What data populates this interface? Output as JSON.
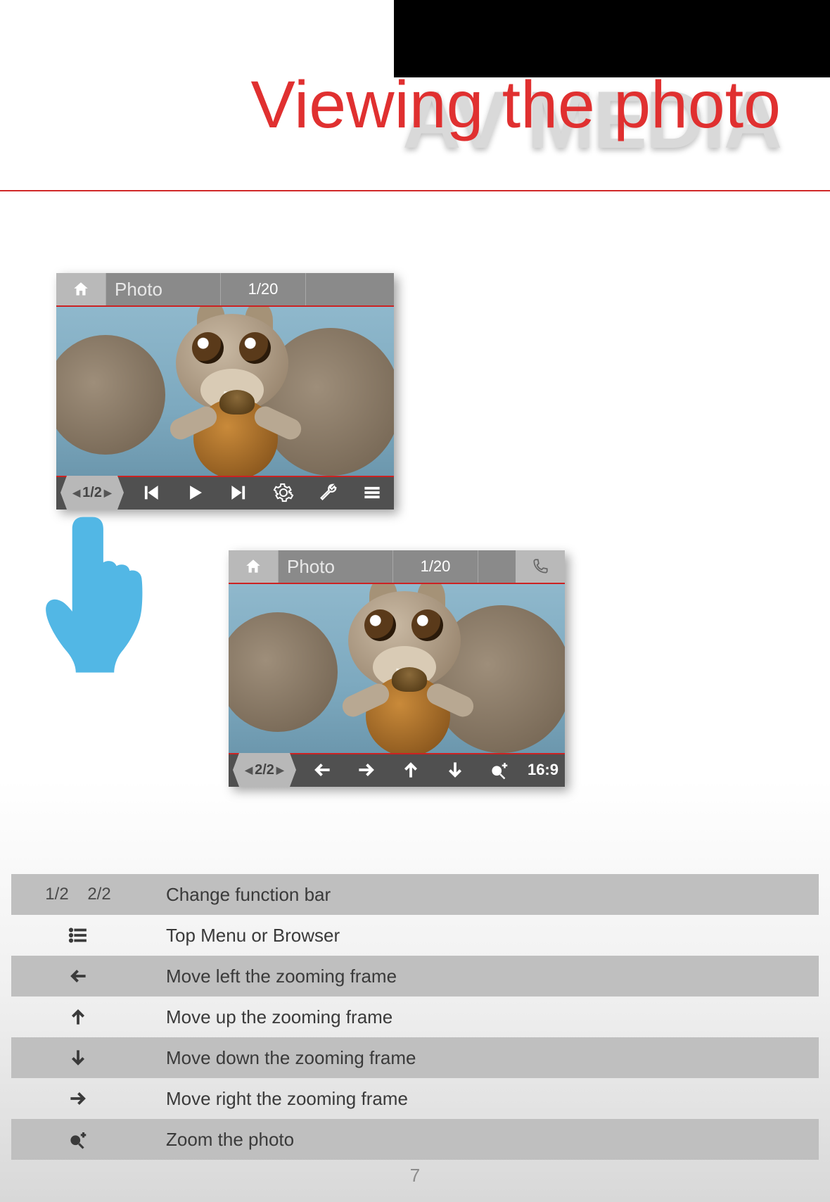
{
  "header": {
    "bg_title": "AV MEDIA",
    "fg_title": "Viewing the photo"
  },
  "device1": {
    "title": "Photo",
    "count": "1/20",
    "pager": "1/2"
  },
  "device2": {
    "title": "Photo",
    "count": "1/20",
    "pager": "2/2",
    "aspect": "16:9"
  },
  "legend": {
    "rows": [
      {
        "icon_text": "1/2    2/2",
        "desc": "Change function bar"
      },
      {
        "icon_text": "",
        "desc": "Top Menu or Browser"
      },
      {
        "icon_text": "",
        "desc": "Move left the zooming frame"
      },
      {
        "icon_text": "",
        "desc": "Move up the zooming frame"
      },
      {
        "icon_text": "",
        "desc": "Move down the zooming frame"
      },
      {
        "icon_text": "",
        "desc": "Move right the zooming frame"
      },
      {
        "icon_text": "",
        "desc": "Zoom the photo"
      }
    ]
  },
  "page_number": "7"
}
